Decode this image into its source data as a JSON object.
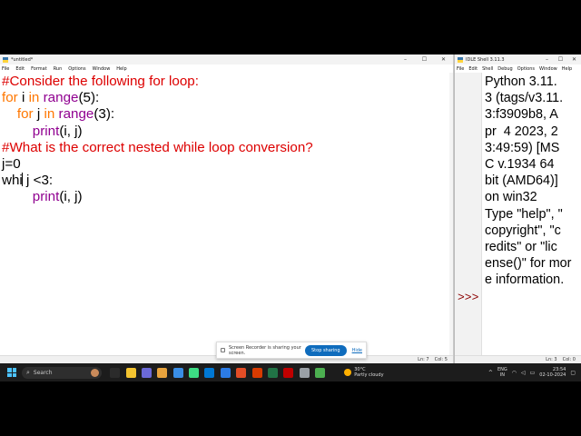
{
  "editor": {
    "title": "*untitled*",
    "menu": [
      "File",
      "Edit",
      "Format",
      "Run",
      "Options",
      "Window",
      "Help"
    ],
    "status": {
      "line": "Ln: 7",
      "col": "Col: 5"
    },
    "code": [
      [
        {
          "t": "#Consider the following for loop:",
          "c": "cm"
        }
      ],
      [
        {
          "t": "for",
          "c": "kw"
        },
        {
          "t": " i "
        },
        {
          "t": "in",
          "c": "kw"
        },
        {
          "t": " "
        },
        {
          "t": "range",
          "c": "bi"
        },
        {
          "t": "(5):"
        }
      ],
      [
        {
          "t": "    "
        },
        {
          "t": "for",
          "c": "kw"
        },
        {
          "t": " j "
        },
        {
          "t": "in",
          "c": "kw"
        },
        {
          "t": " "
        },
        {
          "t": "range",
          "c": "bi"
        },
        {
          "t": "(3):"
        }
      ],
      [
        {
          "t": "        "
        },
        {
          "t": "print",
          "c": "bi"
        },
        {
          "t": "(i, j)"
        }
      ],
      [
        {
          "t": "#What is the correct nested while loop conversion?",
          "c": "cm"
        }
      ],
      [
        {
          "t": "j=0"
        }
      ],
      [
        {
          "t": "whi"
        },
        {
          "cursor": true
        },
        {
          "t": " j <3:"
        }
      ],
      [
        {
          "t": "        "
        },
        {
          "t": "print",
          "c": "bi"
        },
        {
          "t": "(i, j)"
        }
      ]
    ]
  },
  "shell": {
    "title": "IDLE Shell 3.11.3",
    "menu": [
      "File",
      "Edit",
      "Shell",
      "Debug",
      "Options",
      "Window",
      "Help"
    ],
    "prompt": ">>>",
    "status": {
      "line": "Ln: 3",
      "col": "Col: 0"
    },
    "lines": [
      "Python 3.11.",
      "3 (tags/v3.11.",
      "3:f3909b8, A",
      "pr  4 2023, 2",
      "3:49:59) [MS",
      "C v.1934 64",
      "bit (AMD64)]",
      "on win32",
      "Type \"help\", \"",
      "copyright\", \"c",
      "redits\" or \"lic",
      "ense()\" for mor",
      "e information."
    ]
  },
  "recorder": {
    "message": "Screen Recorder is sharing your screen.",
    "stop_label": "Stop sharing",
    "hide_label": "Hide"
  },
  "taskbar": {
    "search_placeholder": "Search",
    "weather_temp": "30°C",
    "weather_desc": "Partly cloudy",
    "lang_line1": "ENG",
    "lang_line2": "IN",
    "time": "23:54",
    "date": "02-10-2024",
    "app_colors": [
      "#2b2b2b",
      "#f4c430",
      "#6b69d6",
      "#e8a33d",
      "#3a8ee6",
      "#3ddc84",
      "#0078d4",
      "#2c7be5",
      "#e44d26",
      "#d83b01",
      "#217346",
      "#c00000",
      "#9aa0a6",
      "#4caf50"
    ]
  },
  "colors": {
    "comment": "#dd0000",
    "keyword": "#ff7700",
    "builtin": "#900090",
    "prompt": "#8b0000",
    "accent": "#0f6cbd"
  }
}
